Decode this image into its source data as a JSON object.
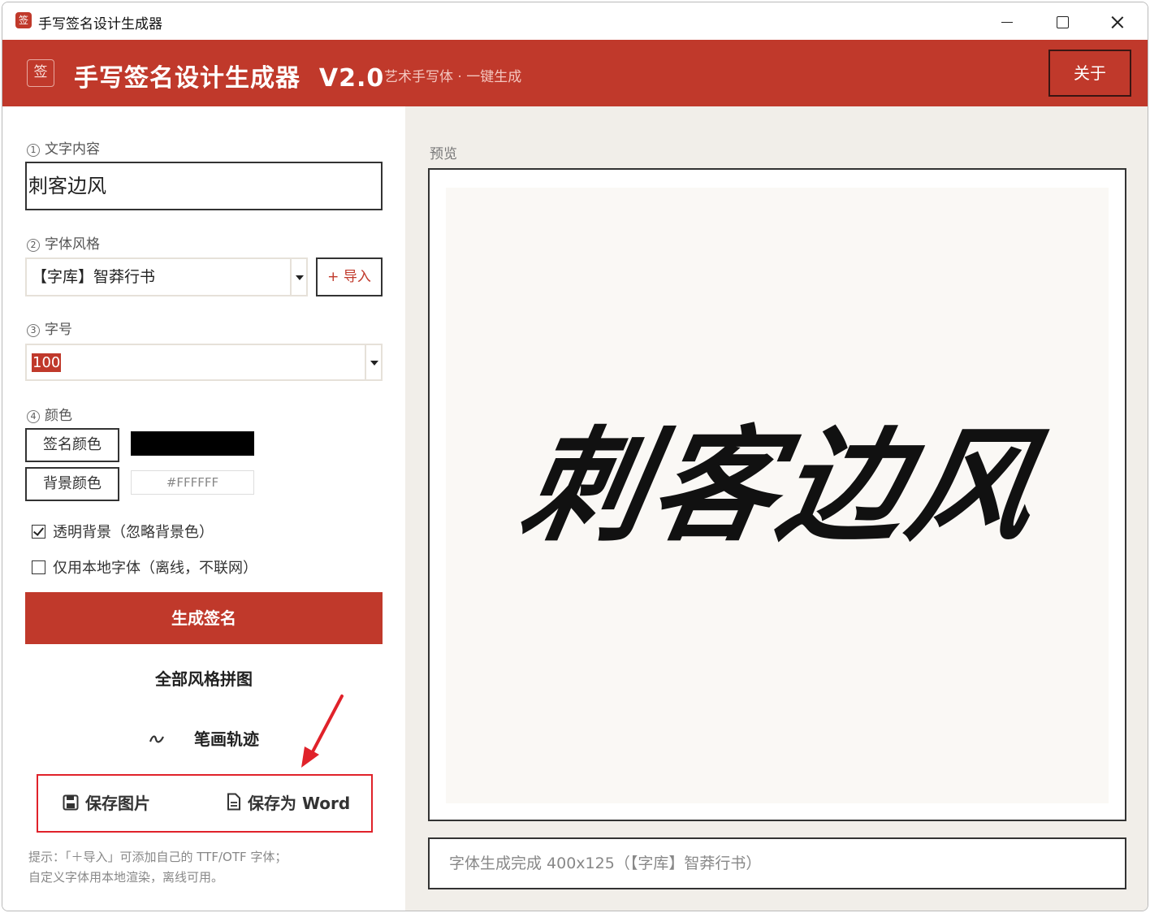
{
  "window": {
    "title": "手写签名设计生成器",
    "icon_char": "签"
  },
  "header": {
    "logo_char": "签",
    "brand": "手写签名设计生成器  V2.0",
    "tagline": "艺术手写体 · 一键生成",
    "about_label": "关于",
    "accent_color": "#c0392b"
  },
  "form": {
    "text_section": {
      "num": "1",
      "label": "文字内容",
      "value": "刺客边风"
    },
    "font_section": {
      "num": "2",
      "label": "字体风格",
      "selected": "【字库】智莽行书",
      "import_label": "+ 导入"
    },
    "size_section": {
      "num": "3",
      "label": "字号",
      "value": "100"
    },
    "color_section": {
      "num": "4",
      "label": "颜色",
      "sign_color_label": "签名颜色",
      "sign_color": "#000000",
      "bg_color_label": "背景颜色",
      "bg_color_value": "#FFFFFF"
    },
    "transparent_bg": {
      "label": "透明背景（忽略背景色）",
      "checked": true
    },
    "local_font_only": {
      "label": "仅用本地字体（离线，不联网）",
      "checked": false
    },
    "generate_label": "生成签名",
    "mosaic_label": "全部风格拼图",
    "strokes_label": "笔画轨迹",
    "strokes_icon": "brush-stroke-icon",
    "save_image_label": "保存图片",
    "save_image_icon": "floppy-disk-icon",
    "save_word_label": "保存为 Word",
    "save_word_icon": "document-icon",
    "tip_line1": "提示：「＋导入」可添加自己的 TTF/OTF 字体；",
    "tip_line2": "自定义字体用本地渲染，离线可用。"
  },
  "preview": {
    "label": "预览",
    "signature_text": "刺客边风",
    "status": "字体生成完成 400x125（【字库】智莽行书）"
  }
}
